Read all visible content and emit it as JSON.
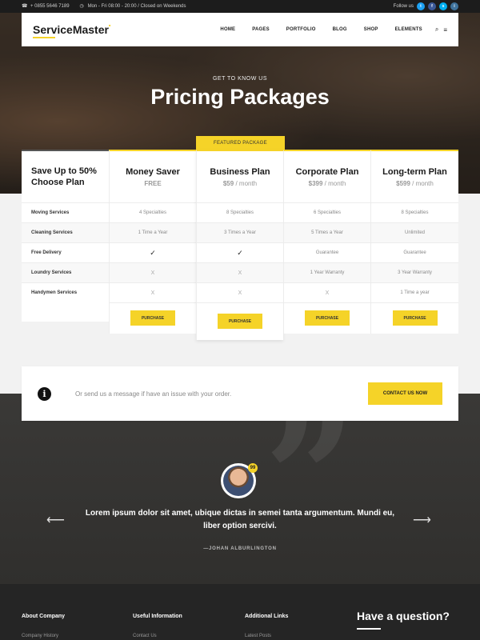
{
  "topbar": {
    "phone": "+ 0855 5646 7189",
    "hours": "Mon - Fri 08:00 - 20:00 / Closed on Weekends",
    "follow_label": "Follow us",
    "socials": [
      {
        "icon": "twitter-icon",
        "glyph": "t",
        "color": "#1da1f2"
      },
      {
        "icon": "facebook-icon",
        "glyph": "f",
        "color": "#3b5998"
      },
      {
        "icon": "skype-icon",
        "glyph": "s",
        "color": "#00aff0"
      },
      {
        "icon": "instagram-icon",
        "glyph": "i",
        "color": "#3f729b"
      }
    ]
  },
  "header": {
    "logo": "ServiceMaster",
    "nav": [
      "HOME",
      "PAGES",
      "PORTFOLIO",
      "BLOG",
      "SHOP",
      "ELEMENTS"
    ]
  },
  "hero": {
    "kicker": "GET TO KNOW US",
    "title": "Pricing Packages"
  },
  "pricing": {
    "featured_label": "FEATURED PACKAGE",
    "intro": "Save Up to 50% Choose Plan",
    "features": [
      "Moving Services",
      "Cleaning Services",
      "Free Delivery",
      "Loundry Services",
      "Handymen Services"
    ],
    "purchase_label": "PURCHASE",
    "per_month": "/ month",
    "plans": [
      {
        "name": "Money Saver",
        "price": "FREE",
        "per": "",
        "values": [
          "4 Specialties",
          "1 Time a Year",
          "✓",
          "X",
          "X"
        ]
      },
      {
        "name": "Business Plan",
        "price": "$59",
        "per": "/ month",
        "values": [
          "8 Specialties",
          "3 Times a Year",
          "✓",
          "X",
          "X"
        ]
      },
      {
        "name": "Corporate Plan",
        "price": "$399",
        "per": "/ month",
        "values": [
          "6 Specialties",
          "5 Times a Year",
          "Guarantee",
          "1 Year Warranty",
          "X"
        ]
      },
      {
        "name": "Long-term Plan",
        "price": "$599",
        "per": "/ month",
        "values": [
          "8 Specialties",
          "Unlimited",
          "Guarantee",
          "3 Year Warranty",
          "1 Time a year"
        ]
      }
    ]
  },
  "contact": {
    "message": "Or send us a message if have an issue with your order.",
    "button": "CONTACT US NOW"
  },
  "testimonial": {
    "badge": "99",
    "quote": "Lorem ipsum dolor sit amet, ubique dictas in semei tanta argumentum. Mundi eu, liber option sercivi.",
    "author": "—JOHAN ALBURLINGTON"
  },
  "footer": {
    "columns": [
      {
        "heading": "About Company",
        "link": "Company History"
      },
      {
        "heading": "Useful Information",
        "link": "Contact Us"
      },
      {
        "heading": "Additional Links",
        "link": "Latest Posts"
      }
    ],
    "question": "Have a question?"
  },
  "colors": {
    "accent": "#f5d328",
    "dark": "#252525"
  }
}
